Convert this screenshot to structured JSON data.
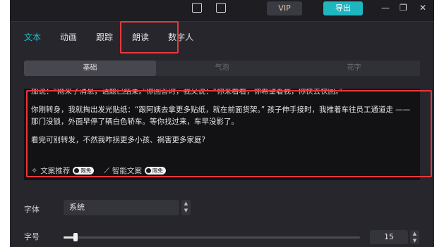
{
  "topbar": {
    "vip_label": "VIP",
    "export_label": "导出",
    "minimize": "—",
    "restore": "❐",
    "close": "✕"
  },
  "tabs": [
    {
      "label": "文本",
      "active": true
    },
    {
      "label": "动画",
      "active": false
    },
    {
      "label": "跟踪",
      "active": false
    },
    {
      "label": "朗读",
      "active": false
    },
    {
      "label": "数字人",
      "active": false
    }
  ],
  "subtabs": [
    {
      "label": "基础",
      "active": true
    },
    {
      "label": "气泡",
      "active": false
    },
    {
      "label": "花字",
      "active": false
    }
  ],
  "text_editor": {
    "partial_line": "加说：“刚来了消息，话题已结束。”你回答时，我又说：“你来看看，你希望着我，你快去快回。”",
    "paragraph_1": "你刚转身，我就掏出发光贴纸：“跟阿姨去拿更多贴纸，就在前面货架。” 孩子伸手接时，我推着车往员工通道走 —— 那门没锁，外面早停了辆白色轿车。等你找过来，车早没影了。",
    "paragraph_2": "看完可别转发，不然我咋拐更多小孩、祸害更多家庭?",
    "tool_recommend": "文案推荐",
    "tool_smart": "智能文案",
    "badge_free": "限免"
  },
  "style": {
    "font_label": "字体",
    "font_value": "系统",
    "size_label": "字号",
    "size_value": "15",
    "size_fraction": 0.04
  },
  "colors": {
    "accent": "#20c4cc",
    "highlight": "#e8383d",
    "panel": "#26262c"
  }
}
